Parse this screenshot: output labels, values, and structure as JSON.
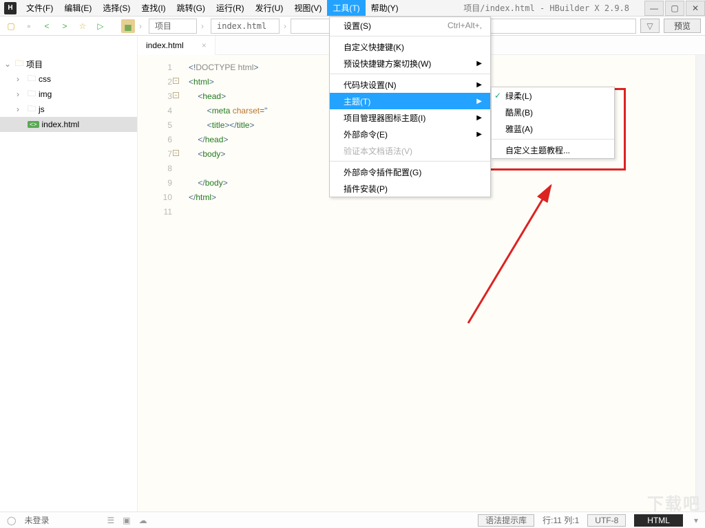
{
  "app": {
    "icon_letter": "H",
    "title": "项目/index.html - HBuilder X 2.9.8"
  },
  "menubar": [
    "文件(F)",
    "编辑(E)",
    "选择(S)",
    "查找(I)",
    "跳转(G)",
    "运行(R)",
    "发行(U)",
    "视图(V)",
    "工具(T)",
    "帮助(Y)"
  ],
  "menubar_active_index": 8,
  "toolbar": {
    "breadcrumb": [
      "项目",
      "index.html"
    ],
    "preview_label": "预览",
    "search_placeholder": ""
  },
  "sidebar": {
    "root": "项目",
    "folders": [
      "css",
      "img",
      "js"
    ],
    "files": [
      {
        "name": "index.html",
        "selected": true
      }
    ]
  },
  "editor": {
    "tab_name": "index.html",
    "lines": [
      {
        "n": 1,
        "html": "<span class='k-punct'>&lt;!</span><span class='k-doctype'>DOCTYPE html</span><span class='k-punct'>&gt;</span>"
      },
      {
        "n": 2,
        "fold": true,
        "html": "<span class='k-punct'>&lt;</span><span class='k-tag'>html</span><span class='k-punct'>&gt;</span>"
      },
      {
        "n": 3,
        "fold": true,
        "bp": true,
        "indent": 1,
        "html": "<span class='k-punct'>&lt;</span><span class='k-tag'>head</span><span class='k-punct'>&gt;</span>"
      },
      {
        "n": 4,
        "indent": 2,
        "html": "<span class='k-punct'>&lt;</span><span class='k-tag'>meta</span> <span class='k-attr'>charset</span><span class='k-punct'>=\"</span>"
      },
      {
        "n": 5,
        "indent": 2,
        "html": "<span class='k-punct'>&lt;</span><span class='k-tag'>title</span><span class='k-punct'>&gt;&lt;/</span><span class='k-tag'>title</span><span class='k-punct'>&gt;</span>"
      },
      {
        "n": 6,
        "indent": 1,
        "html": "<span class='k-punct'>&lt;/</span><span class='k-tag'>head</span><span class='k-punct'>&gt;</span>"
      },
      {
        "n": 7,
        "fold": true,
        "indent": 1,
        "html": "<span class='k-punct'>&lt;</span><span class='k-tag'>body</span><span class='k-punct'>&gt;</span>"
      },
      {
        "n": 8,
        "indent": 2,
        "html": ""
      },
      {
        "n": 9,
        "indent": 1,
        "html": "<span class='k-punct'>&lt;/</span><span class='k-tag'>body</span><span class='k-punct'>&gt;</span>"
      },
      {
        "n": 10,
        "html": "<span class='k-punct'>&lt;/</span><span class='k-tag'>html</span><span class='k-punct'>&gt;</span>"
      },
      {
        "n": 11,
        "html": ""
      }
    ]
  },
  "tools_menu": {
    "items": [
      {
        "label": "设置(S)",
        "shortcut": "Ctrl+Alt+,",
        "type": "item"
      },
      {
        "type": "sep"
      },
      {
        "label": "自定义快捷键(K)",
        "type": "item"
      },
      {
        "label": "预设快捷键方案切换(W)",
        "type": "sub"
      },
      {
        "type": "sep"
      },
      {
        "label": "代码块设置(N)",
        "type": "sub"
      },
      {
        "label": "主题(T)",
        "type": "sub",
        "highlight": true
      },
      {
        "label": "项目管理器图标主题(I)",
        "type": "sub"
      },
      {
        "label": "外部命令(E)",
        "type": "sub"
      },
      {
        "label": "验证本文档语法(V)",
        "type": "item",
        "disabled": true
      },
      {
        "type": "sep"
      },
      {
        "label": "外部命令插件配置(G)",
        "type": "item"
      },
      {
        "label": "插件安装(P)",
        "type": "item"
      }
    ]
  },
  "theme_submenu": {
    "items": [
      {
        "label": "绿柔(L)",
        "checked": true
      },
      {
        "label": "酷黑(B)"
      },
      {
        "label": "雅蓝(A)"
      },
      {
        "type": "sep"
      },
      {
        "label": "自定义主题教程..."
      }
    ]
  },
  "statusbar": {
    "login": "未登录",
    "hint_lib": "语法提示库",
    "cursor": "行:11 列:1",
    "encoding": "UTF-8",
    "lang": "HTML"
  },
  "watermark": "下载吧"
}
